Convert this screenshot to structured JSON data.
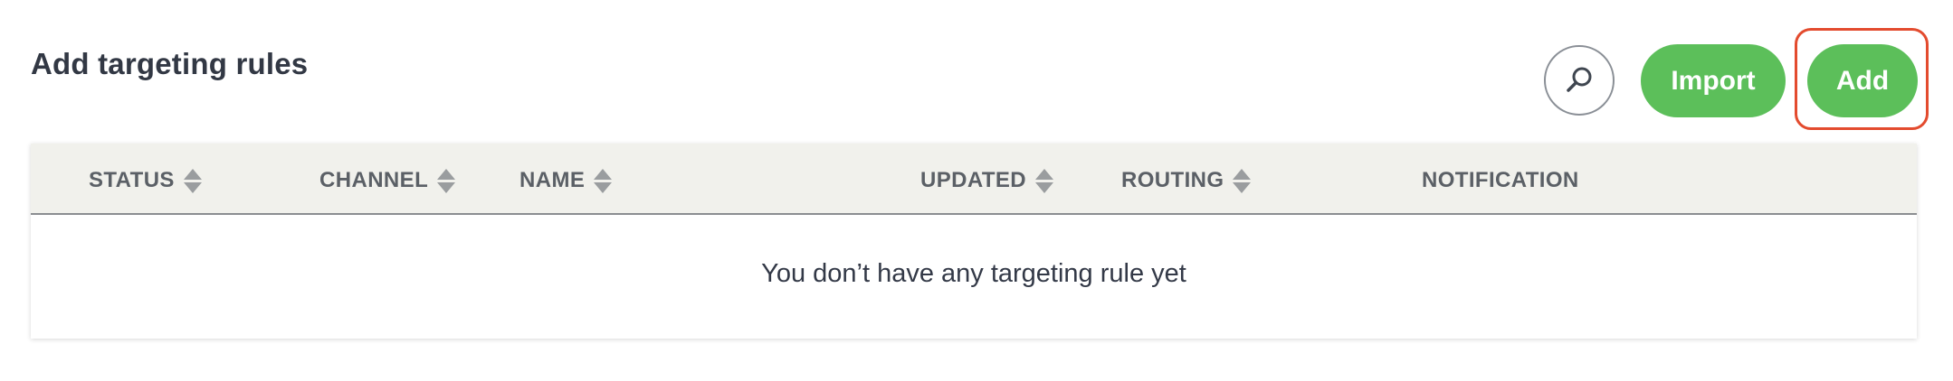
{
  "header": {
    "title": "Add targeting rules"
  },
  "toolbar": {
    "search_icon": "search-icon",
    "import_label": "Import",
    "add_label": "Add",
    "accent_color": "#5cbf5a",
    "highlight_color": "#e34b2e"
  },
  "table": {
    "columns": [
      {
        "label": "STATUS",
        "sortable": true
      },
      {
        "label": "CHANNEL",
        "sortable": true
      },
      {
        "label": "NAME",
        "sortable": true
      },
      {
        "label": "UPDATED",
        "sortable": true
      },
      {
        "label": "ROUTING",
        "sortable": true
      },
      {
        "label": "NOTIFICATION",
        "sortable": false
      }
    ],
    "empty_message": "You don’t have any targeting rule yet"
  }
}
